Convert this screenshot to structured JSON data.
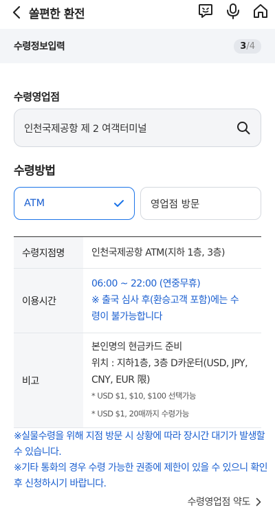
{
  "header": {
    "title": "쏠편한 환전",
    "back_icon": "chevron-left-icon",
    "icons": [
      "chat-icon",
      "microphone-icon",
      "home-icon"
    ]
  },
  "step": {
    "title": "수령정보입력",
    "current": "3",
    "separator": "/",
    "total": "4"
  },
  "branch": {
    "label": "수령영업점",
    "value": "인천국제공항 제 2 여객터미널",
    "icon": "search-icon"
  },
  "method": {
    "label": "수령방법",
    "options": [
      {
        "label": "ATM",
        "selected": true
      },
      {
        "label": "영업점 방문",
        "selected": false
      }
    ]
  },
  "table": {
    "rows": [
      {
        "head": "수령지점명",
        "lines": [
          "인천국제공항 ATM(지하 1층, 3층)"
        ]
      },
      {
        "head": "이용시간",
        "lines": [
          "06:00 ~ 22:00 (연중무휴)",
          "※ 출국 심사 후(환승고객 포함)에는 수",
          "령이 불가능합니다"
        ]
      },
      {
        "head": "비고",
        "lines": [
          "본인명의 현금카드 준비",
          "위치 : 지하1층, 3층 D카운터(USD, JPY,",
          "CNY, EUR 限)"
        ],
        "notes": [
          "* USD $1, $10, $100 선택가능",
          "* USD $1, 20매까지 수령가능"
        ]
      }
    ]
  },
  "notices": [
    "※실물수령을 위해 지점 방문 시 상황에 따라 장시간 대기가 발생할 수 있습니다.",
    "※기타 통화의 경우 수령 가능한 권종에 제한이 있을 수 있으니 확인 후 신청하시기 바랍니다."
  ],
  "terms": {
    "label": "수령영업점 약도",
    "icon": "chevron-right-icon"
  },
  "colors": {
    "accent": "#1a5fd0",
    "step_bar_bg": "#f3f5f8"
  }
}
